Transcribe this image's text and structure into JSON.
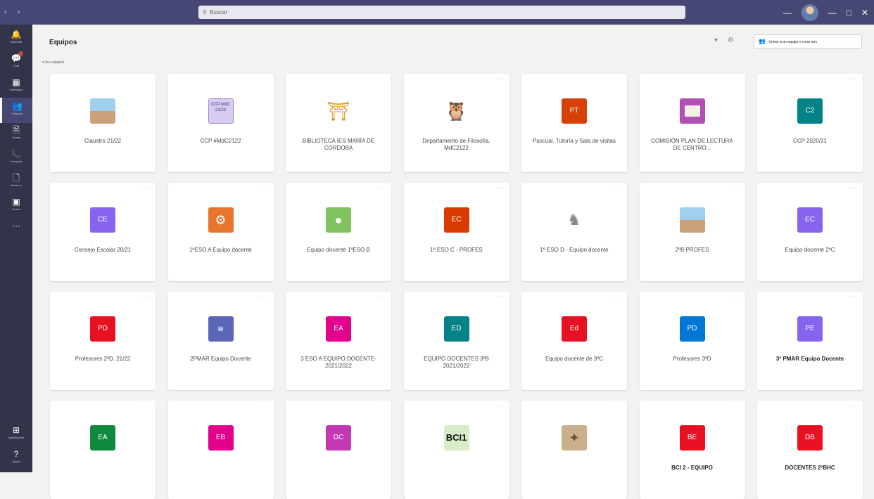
{
  "titlebar": {
    "search_placeholder": "Buscar",
    "nav": "‹ ›",
    "window_controls": [
      "—",
      "□",
      "✕"
    ]
  },
  "rail": {
    "items": [
      {
        "icon": "bell-icon",
        "glyph": "🔔",
        "label": "Actividad"
      },
      {
        "icon": "chat-icon",
        "glyph": "💬",
        "label": "Chat",
        "badge": true
      },
      {
        "icon": "calendar-icon",
        "glyph": "▦",
        "label": "Calendario"
      },
      {
        "icon": "teams-icon",
        "glyph": "👥",
        "label": "Equipos",
        "active": true
      },
      {
        "icon": "assignments-icon",
        "glyph": "🗎",
        "label": "Tareas"
      },
      {
        "icon": "calls-icon",
        "glyph": "📞",
        "label": "Llamadas"
      },
      {
        "icon": "files-icon",
        "glyph": "🗋",
        "label": "Archivos"
      },
      {
        "icon": "shifts-icon",
        "glyph": "▣",
        "label": "Turnos"
      },
      {
        "icon": "more-icon",
        "glyph": "···",
        "label": ""
      }
    ],
    "bottom": [
      {
        "icon": "apps-icon",
        "glyph": "⊞",
        "label": "Aplicaciones"
      },
      {
        "icon": "help-icon",
        "glyph": "?",
        "label": "Ayuda"
      }
    ]
  },
  "header": {
    "title": "Equipos",
    "join_button": "Unirse a un equipo o crear uno",
    "section_label": "Sus equipos"
  },
  "teams": [
    {
      "name": "Claustro 21/22",
      "logo_text": "",
      "color": "#9fd0ee",
      "style": "img-sky"
    },
    {
      "name": "CCP #MdC2122",
      "logo_text": "CCP MdC 21/22",
      "color": "#d8ccf0",
      "style": "img-ccp"
    },
    {
      "name": "BIBLIOTECA IES MARÍA DE CÓRDOBA",
      "logo_text": "",
      "color": "#e8961e",
      "style": "img-bib"
    },
    {
      "name": "Departamento de Filosofía. MdC2122",
      "logo_text": "",
      "color": "#333333",
      "style": "img-owl"
    },
    {
      "name": "Pascual. Tutoría y Sala de visitas",
      "logo_text": "PT",
      "color": "#d74108"
    },
    {
      "name": "COMISIÓN PLAN DE LECTURA DE CENTRO...",
      "logo_text": "",
      "color": "#b14fb6",
      "style": "img-book"
    },
    {
      "name": "CCP 2020/21",
      "logo_text": "C2",
      "color": "#038387"
    },
    {
      "name": "Consejo Escolar 20/21",
      "logo_text": "CE",
      "color": "#8764f0"
    },
    {
      "name": "1ºESO A Equipo docente",
      "logo_text": "",
      "color": "#e8742e",
      "style": "img-gears"
    },
    {
      "name": "Equipo docente 1ºESO B",
      "logo_text": "",
      "color": "#7fc45e",
      "style": "img-chat"
    },
    {
      "name": "1º ESO C - PROFES",
      "logo_text": "EC",
      "color": "#d83b01"
    },
    {
      "name": "1º ESO D - Equipo docente",
      "logo_text": "",
      "color": "#8a8886",
      "style": "img-stat"
    },
    {
      "name": "2ºB PROFES",
      "logo_text": "",
      "color": "#9fd0ee",
      "style": "img-sky"
    },
    {
      "name": "Equipo docente 2ºC",
      "logo_text": "EC",
      "color": "#8764f0"
    },
    {
      "name": "Profesores 2ºD. 21/22",
      "logo_text": "PD",
      "color": "#e81123"
    },
    {
      "name": "2PMAR Equipo Docente",
      "logo_text": "",
      "color": "#5b66b8",
      "style": "img-ppt"
    },
    {
      "name": "3 ESO A EQUIPO DOCENTE- 2021/2022",
      "logo_text": "EA",
      "color": "#e3008c"
    },
    {
      "name": "EQUIPO DOCENTES 3ºB 2021/2022",
      "logo_text": "ED",
      "color": "#038387"
    },
    {
      "name": "Equipo docente de 3ºC",
      "logo_text": "Ed",
      "color": "#e81123"
    },
    {
      "name": "Profesores 3ºD",
      "logo_text": "PD",
      "color": "#0078d4"
    },
    {
      "name": "3º PMAR Equipo Docente",
      "logo_text": "PE",
      "color": "#8764f0",
      "bold": true
    },
    {
      "name": "",
      "logo_text": "EA",
      "color": "#10893e"
    },
    {
      "name": "",
      "logo_text": "EB",
      "color": "#e3008c"
    },
    {
      "name": "",
      "logo_text": "DC",
      "color": "#c239b3"
    },
    {
      "name": "",
      "logo_text": "BCI1",
      "color": "#d9ecc8",
      "style": "img-bci"
    },
    {
      "name": "",
      "logo_text": "",
      "color": "#c9b08a",
      "style": "img-dav"
    },
    {
      "name": "BCI 2 - EQUIPO",
      "logo_text": "BE",
      "color": "#e81123",
      "bold": true
    },
    {
      "name": "DOCENTES 2ºBHC",
      "logo_text": "DB",
      "color": "#e81123",
      "bold": true
    }
  ]
}
